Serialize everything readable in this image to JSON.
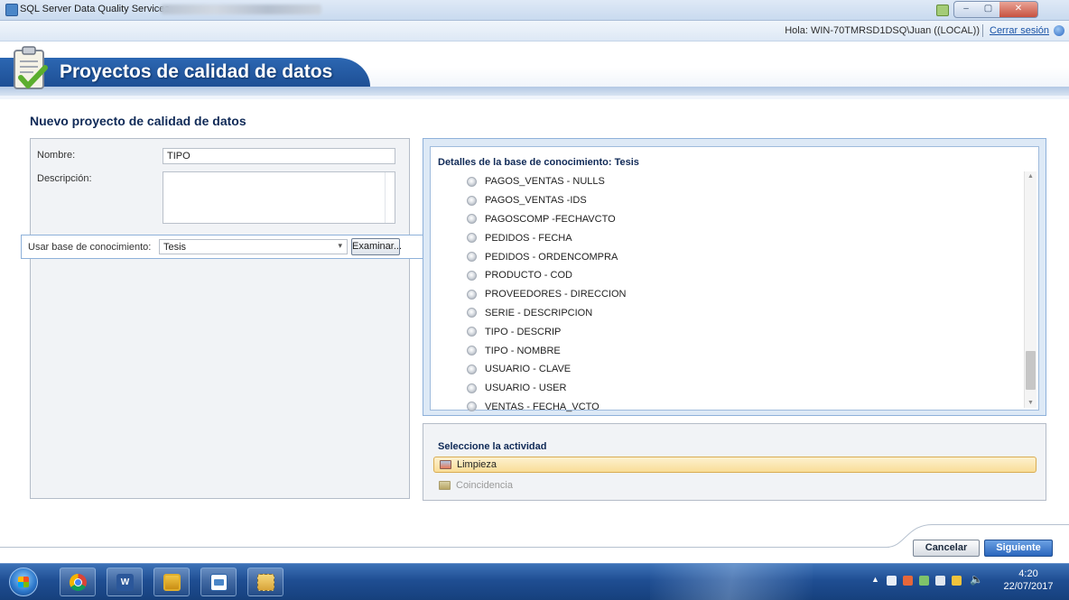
{
  "window": {
    "title": "SQL Server Data Quality Services",
    "controls": {
      "minimize": "–",
      "maximize": "▢",
      "close": "✕"
    }
  },
  "userbar": {
    "greeting": "Hola: WIN-70TMRSD1DSQ\\Juan ((LOCAL))",
    "logout": "Cerrar sesión",
    "help_icon": "help-icon"
  },
  "banner": {
    "title": "Proyectos de calidad de datos",
    "icon": "clipboard-check-icon"
  },
  "page": {
    "heading": "Nuevo proyecto de calidad de datos"
  },
  "form": {
    "name_label": "Nombre:",
    "name_value": "TIPO",
    "description_label": "Descripción:",
    "description_value": "",
    "kb_label": "Usar base de conocimiento:",
    "kb_value": "Tesis",
    "browse_button": "Examinar..."
  },
  "kb_details": {
    "title": "Detalles de la base de conocimiento: Tesis",
    "domains": [
      "PAGOS_VENTAS - NULLS",
      "PAGOS_VENTAS -IDS",
      "PAGOSCOMP -FECHAVCTO",
      "PEDIDOS - FECHA",
      "PEDIDOS - ORDENCOMPRA",
      "PRODUCTO - COD",
      "PROVEEDORES - DIRECCION",
      "SERIE - DESCRIPCION",
      "TIPO - DESCRIP",
      "TIPO - NOMBRE",
      "USUARIO - CLAVE",
      "USUARIO - USER",
      "VENTAS - FECHA_VCTO"
    ]
  },
  "activity": {
    "title": "Seleccione la actividad",
    "items": [
      {
        "label": "Limpieza",
        "state": "selected"
      },
      {
        "label": "Coincidencia",
        "state": "disabled"
      }
    ]
  },
  "footer": {
    "cancel": "Cancelar",
    "next": "Siguiente"
  },
  "taskbar": {
    "apps": [
      "start-orb",
      "chrome",
      "word",
      "app",
      "dqs-client",
      "tool"
    ],
    "clock_time": "4:20",
    "clock_date": "22/07/2017"
  },
  "colors": {
    "banner_blue": "#1e4f95",
    "heading_navy": "#102a57",
    "selection_orange": "#f9dd97",
    "primary_button": "#2a66bd"
  }
}
